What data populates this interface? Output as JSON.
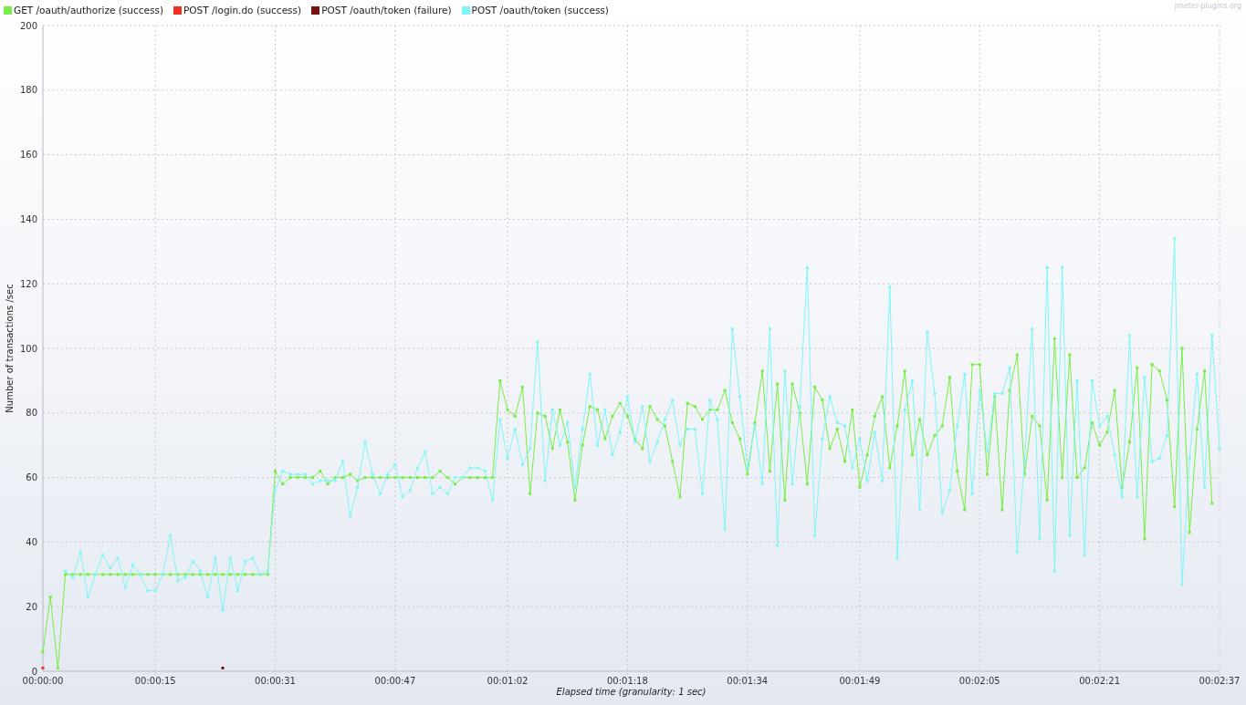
{
  "chart": {
    "credit": "jmeter-plugins.org",
    "chart_data": {
      "type": "line",
      "xlabel": "Elapsed time (granularity: 1 sec)",
      "ylabel": "Number of transactions /sec",
      "grid": true,
      "x": [
        0,
        1,
        2,
        3,
        4,
        5,
        6,
        7,
        8,
        9,
        10,
        11,
        12,
        13,
        14,
        15,
        16,
        17,
        18,
        19,
        20,
        21,
        22,
        23,
        24,
        25,
        26,
        27,
        28,
        29,
        30,
        31,
        32,
        33,
        34,
        35,
        36,
        37,
        38,
        39,
        40,
        41,
        42,
        43,
        44,
        45,
        46,
        47,
        48,
        49,
        50,
        51,
        52,
        53,
        54,
        55,
        56,
        57,
        58,
        59,
        60,
        61,
        62,
        63,
        64,
        65,
        66,
        67,
        68,
        69,
        70,
        71,
        72,
        73,
        74,
        75,
        76,
        77,
        78,
        79,
        80,
        81,
        82,
        83,
        84,
        85,
        86,
        87,
        88,
        89,
        90,
        91,
        92,
        93,
        94,
        95,
        96,
        97,
        98,
        99,
        100,
        101,
        102,
        103,
        104,
        105,
        106,
        107,
        108,
        109,
        110,
        111,
        112,
        113,
        114,
        115,
        116,
        117,
        118,
        119,
        120,
        121,
        122,
        123,
        124,
        125,
        126,
        127,
        128,
        129,
        130,
        131,
        132,
        133,
        134,
        135,
        136,
        137,
        138,
        139,
        140,
        141,
        142,
        143,
        144,
        145,
        146,
        147,
        148,
        149,
        150,
        151,
        152,
        153,
        154,
        155,
        156,
        157
      ],
      "xlim": [
        0,
        157
      ],
      "ylim": [
        0,
        200
      ],
      "xticks": [
        {
          "value": 0,
          "label": "00:00:00"
        },
        {
          "value": 15,
          "label": "00:00:15"
        },
        {
          "value": 31,
          "label": "00:00:31"
        },
        {
          "value": 47,
          "label": "00:00:47"
        },
        {
          "value": 62,
          "label": "00:01:02"
        },
        {
          "value": 78,
          "label": "00:01:18"
        },
        {
          "value": 94,
          "label": "00:01:34"
        },
        {
          "value": 109,
          "label": "00:01:49"
        },
        {
          "value": 125,
          "label": "00:02:05"
        },
        {
          "value": 141,
          "label": "00:02:21"
        },
        {
          "value": 157,
          "label": "00:02:37"
        }
      ],
      "yticks": [
        0,
        20,
        40,
        60,
        80,
        100,
        120,
        140,
        160,
        180,
        200
      ],
      "series": [
        {
          "name": "GET /oauth/authorize (success)",
          "color": "#77ee44",
          "marker": "square",
          "values": [
            6,
            23,
            1,
            30,
            30,
            30,
            30,
            30,
            30,
            30,
            30,
            30,
            30,
            30,
            30,
            30,
            30,
            30,
            30,
            30,
            30,
            30,
            30,
            30,
            30,
            30,
            30,
            30,
            30,
            30,
            30,
            62,
            58,
            60,
            60,
            60,
            60,
            62,
            58,
            60,
            60,
            61,
            59,
            60,
            60,
            60,
            60,
            60,
            60,
            60,
            60,
            60,
            60,
            62,
            60,
            58,
            60,
            60,
            60,
            60,
            60,
            90,
            81,
            79,
            88,
            55,
            80,
            79,
            69,
            81,
            71,
            53,
            70,
            82,
            81,
            72,
            79,
            83,
            79,
            72,
            69,
            82,
            78,
            76,
            65,
            54,
            83,
            82,
            78,
            81,
            81,
            87,
            77,
            72,
            61,
            77,
            93,
            62,
            89,
            53,
            89,
            80,
            58,
            88,
            84,
            69,
            75,
            65,
            81,
            57,
            67,
            79,
            85,
            63,
            76,
            93,
            67,
            78,
            67,
            73,
            76,
            91,
            62,
            50,
            95,
            95,
            61,
            85,
            50,
            87,
            98,
            61,
            79,
            76,
            53,
            103,
            60,
            98,
            60,
            63,
            77,
            70,
            74,
            87,
            57,
            71,
            94,
            41,
            95,
            93,
            84,
            51,
            100,
            43,
            75,
            93,
            52,
            null
          ]
        },
        {
          "name": "POST /login.do (success)",
          "color": "#ee3322",
          "marker": "square",
          "values": [
            1,
            null,
            null,
            null,
            null,
            null,
            null,
            null,
            null,
            null,
            null,
            null,
            null,
            null,
            null,
            null,
            null,
            null,
            null,
            null,
            null,
            null,
            null,
            null,
            null,
            null,
            null,
            null,
            null,
            null,
            null,
            null,
            null,
            null,
            null,
            null,
            null,
            null,
            null,
            null,
            null,
            null,
            null,
            null,
            null,
            null,
            null,
            null,
            null,
            null,
            null,
            null,
            null,
            null,
            null,
            null,
            null,
            null,
            null,
            null,
            null,
            null,
            null,
            null,
            null,
            null,
            null,
            null,
            null,
            null,
            null,
            null,
            null,
            null,
            null,
            null,
            null,
            null,
            null,
            null,
            null,
            null,
            null,
            null,
            null,
            null,
            null,
            null,
            null,
            null,
            null,
            null,
            null,
            null,
            null,
            null,
            null,
            null,
            null,
            null,
            null,
            null,
            null,
            null,
            null,
            null,
            null,
            null,
            null,
            null,
            null,
            null,
            null,
            null,
            null,
            null,
            null,
            null,
            null,
            null,
            null,
            null,
            null,
            null,
            null,
            null,
            null,
            null,
            null,
            null,
            null,
            null,
            null,
            null,
            null,
            null,
            null,
            null,
            null,
            null,
            null,
            null,
            null,
            null,
            null,
            null,
            null,
            null,
            null,
            null,
            null,
            null,
            null,
            null,
            null,
            null,
            null,
            null
          ]
        },
        {
          "name": "POST /oauth/token (failure)",
          "color": "#771111",
          "marker": "square",
          "values": [
            null,
            null,
            null,
            null,
            null,
            null,
            null,
            null,
            null,
            null,
            null,
            null,
            null,
            null,
            null,
            null,
            null,
            null,
            null,
            null,
            null,
            null,
            null,
            null,
            1,
            null,
            null,
            null,
            null,
            null,
            null,
            null,
            null,
            null,
            null,
            null,
            null,
            null,
            null,
            null,
            null,
            null,
            null,
            null,
            null,
            null,
            null,
            null,
            null,
            null,
            null,
            null,
            null,
            null,
            null,
            null,
            null,
            null,
            null,
            null,
            null,
            null,
            null,
            null,
            null,
            null,
            null,
            null,
            null,
            null,
            null,
            null,
            null,
            null,
            null,
            null,
            null,
            null,
            null,
            null,
            null,
            null,
            null,
            null,
            null,
            null,
            null,
            null,
            null,
            null,
            null,
            null,
            null,
            null,
            null,
            null,
            null,
            null,
            null,
            null,
            null,
            null,
            null,
            null,
            null,
            null,
            null,
            null,
            null,
            null,
            null,
            null,
            null,
            null,
            null,
            null,
            null,
            null,
            null,
            null,
            null,
            null,
            null,
            null,
            null,
            null,
            null,
            null,
            null,
            null,
            null,
            null,
            null,
            null,
            null,
            null,
            null,
            null,
            null,
            null,
            null,
            null,
            null,
            null,
            null,
            null,
            null,
            null,
            null,
            null,
            null,
            null,
            null,
            null,
            null,
            null,
            null,
            null
          ]
        },
        {
          "name": "POST /oauth/token (success)",
          "color": "#7ff7f7",
          "marker": "square",
          "values": [
            null,
            null,
            null,
            31,
            29,
            37,
            23,
            30,
            36,
            32,
            35,
            26,
            33,
            30,
            25,
            25,
            30,
            42,
            28,
            29,
            34,
            31,
            23,
            35,
            19,
            35,
            25,
            34,
            35,
            30,
            31,
            56,
            62,
            61,
            61,
            61,
            58,
            59,
            59,
            59,
            65,
            48,
            57,
            71,
            61,
            55,
            61,
            64,
            54,
            56,
            63,
            68,
            55,
            57,
            55,
            60,
            60,
            63,
            63,
            62,
            53,
            78,
            66,
            75,
            64,
            69,
            102,
            59,
            81,
            70,
            77,
            57,
            75,
            92,
            70,
            81,
            67,
            74,
            85,
            71,
            82,
            65,
            71,
            78,
            84,
            70,
            75,
            75,
            55,
            84,
            78,
            44,
            106,
            85,
            63,
            76,
            58,
            106,
            39,
            93,
            58,
            82,
            125,
            42,
            72,
            85,
            77,
            76,
            63,
            72,
            59,
            74,
            59,
            119,
            35,
            81,
            90,
            50,
            105,
            86,
            49,
            56,
            76,
            92,
            55,
            87,
            68,
            86,
            86,
            94,
            37,
            65,
            106,
            41,
            125,
            31,
            125,
            42,
            90,
            36,
            90,
            76,
            79,
            67,
            54,
            104,
            54,
            91,
            65,
            66,
            73,
            134,
            27,
            66,
            92,
            57,
            104,
            69
          ]
        }
      ]
    }
  }
}
